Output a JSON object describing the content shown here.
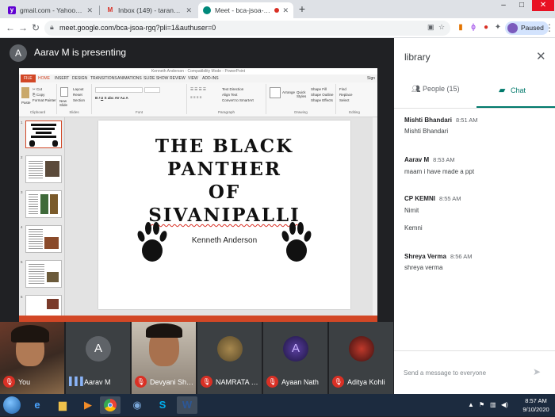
{
  "browser": {
    "tabs": [
      {
        "label": "gmail.com - Yahoo India Search",
        "favicon": "yahoo-favicon"
      },
      {
        "label": "Inbox (149) - tarannum@theindi",
        "favicon": "gmail-favicon"
      },
      {
        "label": "Meet - bca-jsoa-rgq",
        "favicon": "meet-favicon"
      }
    ],
    "url": "meet.google.com/bca-jsoa-rgq?pli=1&authuser=0",
    "profile_status": "Paused"
  },
  "meet": {
    "presenter_initial": "A",
    "presenter_banner": "Aarav M is presenting",
    "participants": [
      {
        "name": "You",
        "muted": true
      },
      {
        "name": "Aarav M",
        "muted": false,
        "initial": "A"
      },
      {
        "name": "Devyani Sharma",
        "muted": true
      },
      {
        "name": "NAMRATA SA...",
        "muted": true
      },
      {
        "name": "Ayaan Nath",
        "muted": true
      },
      {
        "name": "Aditya Kohli",
        "muted": true
      }
    ]
  },
  "presentation": {
    "window_title": "Kenneth Anderson - Compatibility Mode - PowerPoint",
    "slide_title_lines": [
      "THE BLACK",
      "PANTHER",
      "OF",
      "SIVANIPALLI"
    ],
    "slide_author": "Kenneth Anderson"
  },
  "panel": {
    "title": "library",
    "people_tab": "People (15)",
    "chat_tab": "Chat",
    "messages": [
      {
        "sender": "Mishti Bhandari",
        "time": "8:51 AM",
        "lines": [
          "Mishti Bhandari"
        ]
      },
      {
        "sender": "Aarav M",
        "time": "8:53 AM",
        "lines": [
          "maam i have made a ppt"
        ]
      },
      {
        "sender": "CP KEMNI",
        "time": "8:55 AM",
        "lines": [
          "Nimit",
          "Kemni"
        ]
      },
      {
        "sender": "Shreya Verma",
        "time": "8:56 AM",
        "lines": [
          "shreya verma"
        ]
      }
    ],
    "compose_placeholder": "Send a message to everyone"
  },
  "taskbar": {
    "time": "8:57 AM",
    "date": "9/10/2020"
  },
  "colors": {
    "meet_accent": "#00796b",
    "mute_red": "#d93025",
    "powerpoint_orange": "#d24726"
  }
}
